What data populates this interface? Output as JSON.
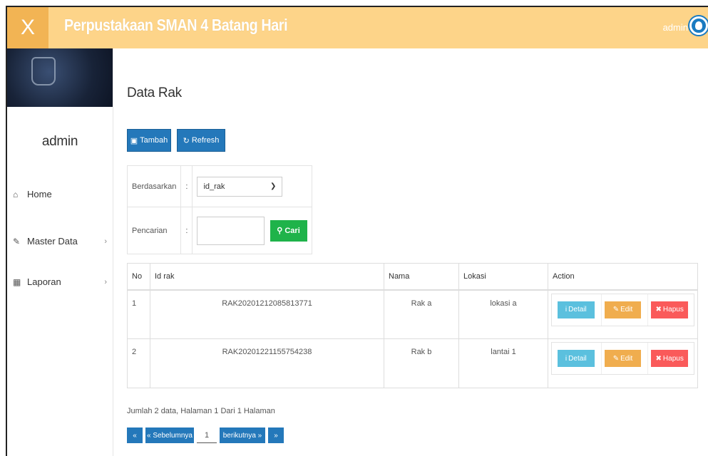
{
  "header": {
    "close_label": "X",
    "title": "Perpustakaan SMAN 4 Batang Hari",
    "user": "admin"
  },
  "sidebar": {
    "user": "admin",
    "items": [
      {
        "label": "Home",
        "icon": "home-icon"
      },
      {
        "label": "Master Data",
        "icon": "edit-icon"
      },
      {
        "label": "Laporan",
        "icon": "calendar-icon"
      }
    ]
  },
  "main": {
    "title": "Data Rak",
    "buttons": {
      "tambah": "Tambah",
      "refresh": "Refresh"
    },
    "filter": {
      "by_label": "Berdasarkan",
      "colon": ":",
      "by_value": "id_rak",
      "search_label": "Pencarian",
      "search_value": "",
      "search_button": "Cari"
    },
    "table": {
      "headers": [
        "No",
        "Id rak",
        "Nama",
        "Lokasi",
        "Action"
      ],
      "rows": [
        {
          "no": "1",
          "id": "RAK20201212085813771",
          "nama": "Rak a",
          "lokasi": "lokasi a"
        },
        {
          "no": "2",
          "id": "RAK20201221155754238",
          "nama": "Rak b",
          "lokasi": "lantai 1"
        }
      ],
      "actions": {
        "detail": "Detail",
        "edit": "Edit",
        "hapus": "Hapus"
      }
    },
    "summary": "Jumlah 2 data, Halaman 1 Dari 1 Halaman",
    "pager": {
      "first": "«",
      "prev": "« Sebelumnya",
      "page": "1",
      "next": "berikutnya »",
      "last": "»"
    }
  },
  "colors": {
    "header": "#fdd489",
    "primary": "#2478ba",
    "success": "#1fb34a",
    "info": "#5bc0de",
    "warning": "#f0ad4e",
    "danger": "#fa5a5a"
  }
}
